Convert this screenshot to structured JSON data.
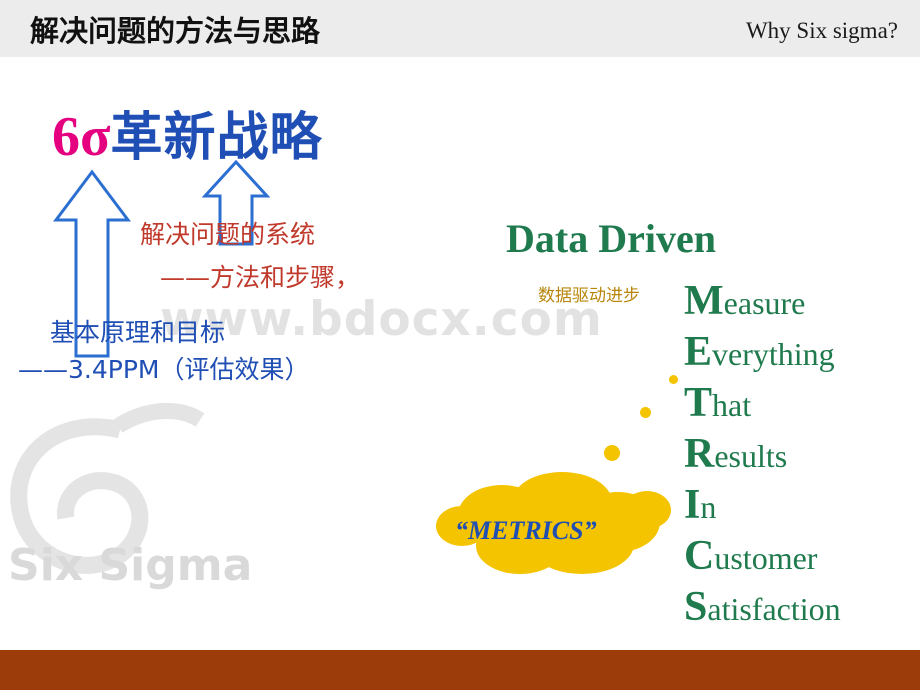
{
  "header": {
    "title": "解决问题的方法与思路",
    "right_label": "Why  Six sigma?"
  },
  "watermark": {
    "text": "www.bdocx.com",
    "logo_label": "Six Sigma"
  },
  "left": {
    "title_symbol": "6σ",
    "title_cn": "革新战略",
    "note_line1": "解决问题的系统",
    "note_line2": "——方法和步骤，",
    "note_line3": "基本原理和目标",
    "note_line4": "——3.4PPM（评估效果）"
  },
  "right": {
    "heading": "Data Driven",
    "heading_cn": "数据驱动进步",
    "cloud_label": "“METRICS”",
    "metrics": [
      {
        "cap": "M",
        "rest": "easure"
      },
      {
        "cap": "E",
        "rest": "verything"
      },
      {
        "cap": "T",
        "rest": "hat"
      },
      {
        "cap": "R",
        "rest": "esults"
      },
      {
        "cap": "I",
        "rest": "n"
      },
      {
        "cap": "C",
        "rest": "ustomer"
      },
      {
        "cap": "S",
        "rest": "atisfaction"
      }
    ]
  },
  "colors": {
    "header_bg": "#ececec",
    "footer_bg": "#9c3c0a",
    "pink": "#e4007f",
    "blue": "#1f4eb4",
    "red": "#c0392b",
    "green": "#1f7a4d",
    "gold": "#f5c400",
    "watermark": "#e2e2e2"
  }
}
